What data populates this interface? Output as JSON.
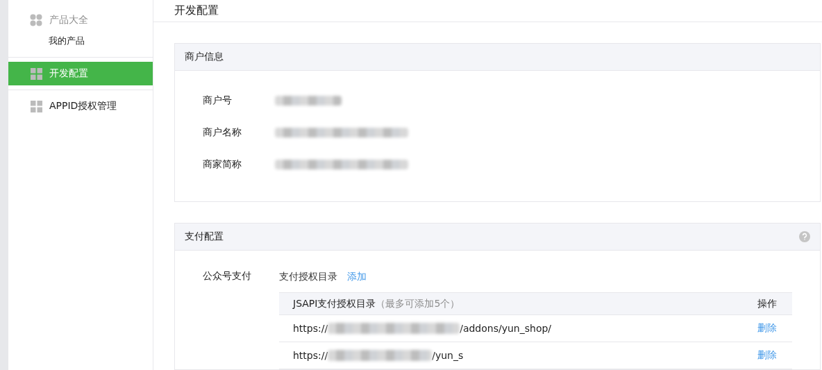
{
  "sidebar": {
    "items": [
      {
        "kind": "group",
        "label": "产品大全",
        "children": [
          {
            "label": "我的产品",
            "selected": false
          }
        ]
      },
      {
        "kind": "item",
        "label": "开发配置",
        "selected": true
      },
      {
        "kind": "item",
        "label": "APPID授权管理",
        "selected": false
      }
    ]
  },
  "page_title": "开发配置",
  "merchant_card": {
    "title": "商户信息",
    "fields": [
      {
        "label": "商户号",
        "redacted": true
      },
      {
        "label": "商户名称",
        "redacted": true
      },
      {
        "label": "商家简称",
        "redacted": true
      }
    ]
  },
  "payment_card": {
    "title": "支付配置",
    "help": true,
    "section": {
      "label": "公众号支付",
      "subtitle": "支付授权目录",
      "add_link": "添加",
      "table": {
        "columns": [
          {
            "title": "JSAPI支付授权目录",
            "note": "（最多可添加5个）"
          },
          {
            "title": "操作"
          }
        ],
        "rows": [
          {
            "url_start": "https://",
            "url_end": "/addons/yun_shop/",
            "action": "删除"
          },
          {
            "url_start": "https://",
            "url_end": "/yun_s",
            "action": "删除"
          }
        ]
      }
    }
  }
}
